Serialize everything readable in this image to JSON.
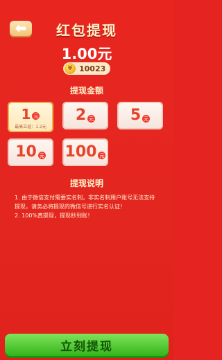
{
  "header": {
    "title": "红包提现"
  },
  "balance": {
    "amount": "1.00元",
    "coins": "10023",
    "coin_icon_glyph": "¥"
  },
  "withdraw_section": {
    "title": "提现金额",
    "options": [
      {
        "value": "1",
        "unit": "元",
        "note": "最高立返：1.2元",
        "selected": true
      },
      {
        "value": "2",
        "unit": "元"
      },
      {
        "value": "5",
        "unit": "元"
      },
      {
        "value": "10",
        "unit": "元"
      },
      {
        "value": "100",
        "unit": "元"
      }
    ]
  },
  "instructions": {
    "title": "提现说明",
    "lines": [
      "1. 由于微信支付需要实名制，非实名制用户账号无法支持提现，请务必将提现的微信号进行实名认证！",
      "2. 100%真提现，提现秒到账！"
    ]
  },
  "actions": {
    "withdraw_label": "立刻提现"
  },
  "colors": {
    "background": "#e52421",
    "accent_gold": "#f4c277",
    "button_green": "#34b51c"
  },
  "icons": {
    "back": "arrow-left-icon",
    "coin": "coin-icon"
  }
}
